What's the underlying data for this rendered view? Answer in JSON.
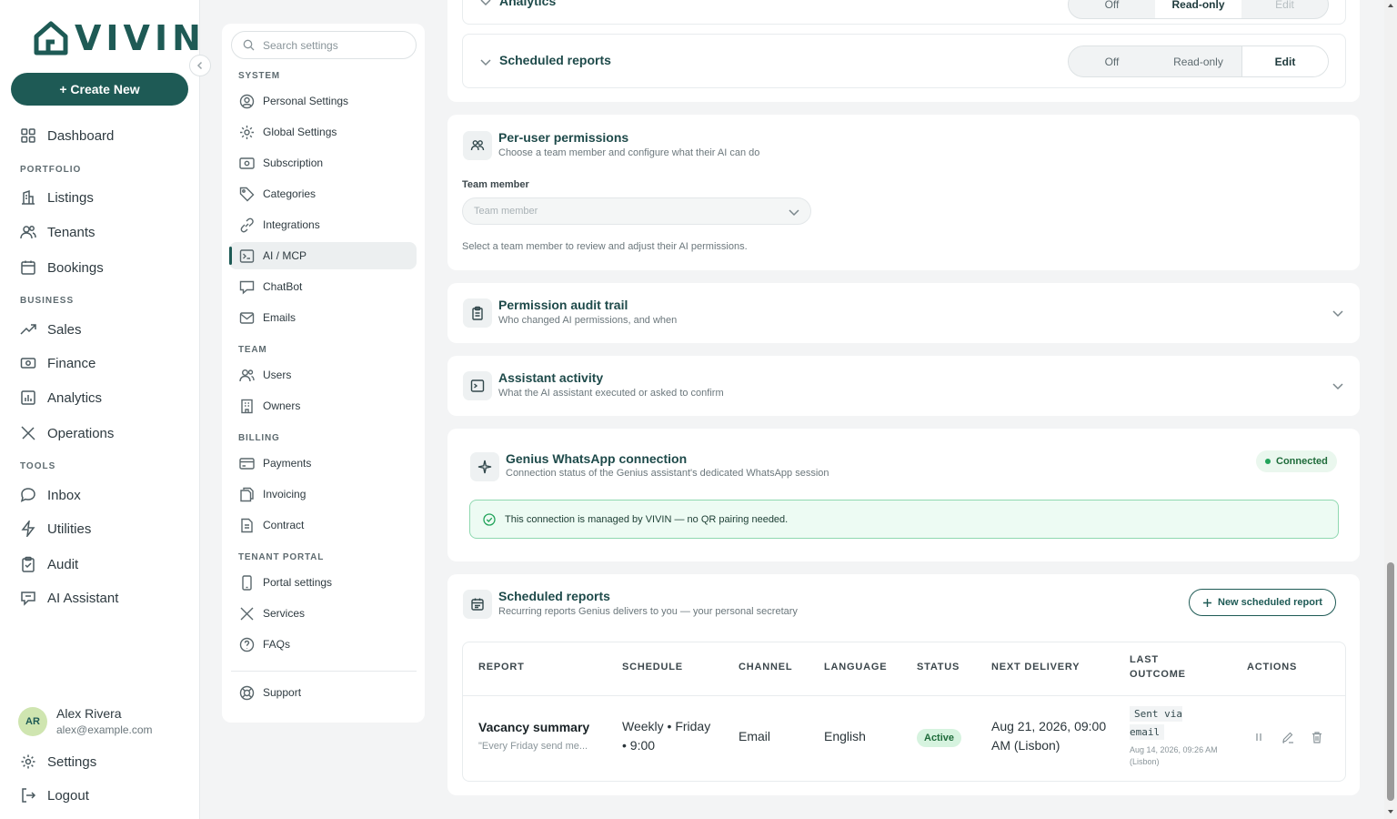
{
  "brand": {
    "logo_text": "VIVIN",
    "create_label": "+ Create New"
  },
  "nav": {
    "dashboard": "Dashboard",
    "portfolio_label": "PORTFOLIO",
    "listings": "Listings",
    "tenants": "Tenants",
    "bookings": "Bookings",
    "business_label": "BUSINESS",
    "sales": "Sales",
    "finance": "Finance",
    "analytics": "Analytics",
    "operations": "Operations",
    "tools_label": "TOOLS",
    "inbox": "Inbox",
    "utilities": "Utilities",
    "audit": "Audit",
    "ai_assistant": "AI Assistant",
    "settings": "Settings",
    "logout": "Logout"
  },
  "user": {
    "initials": "AR",
    "name": "Alex Rivera",
    "email": "alex@example.com"
  },
  "settings_menu": {
    "search_placeholder": "Search settings",
    "system_label": "SYSTEM",
    "personal": "Personal Settings",
    "global": "Global Settings",
    "subscription": "Subscription",
    "categories": "Categories",
    "integrations": "Integrations",
    "ai_mcp": "AI / MCP",
    "chatbot": "ChatBot",
    "emails": "Emails",
    "team_label": "TEAM",
    "users": "Users",
    "owners": "Owners",
    "billing_label": "BILLING",
    "payments": "Payments",
    "invoicing": "Invoicing",
    "contract": "Contract",
    "tenant_portal_label": "TENANT PORTAL",
    "portal_settings": "Portal settings",
    "services": "Services",
    "faqs": "FAQs",
    "support": "Support"
  },
  "access": {
    "analytics_label": "Analytics",
    "scheduled_label": "Scheduled reports",
    "options": [
      "Off",
      "Read-only",
      "Edit"
    ],
    "scheduled_selected": "Edit"
  },
  "per_user": {
    "title": "Per-user permissions",
    "subtitle": "Choose a team member and configure what their AI can do",
    "field_label": "Team member",
    "field_placeholder": "Team member",
    "hint": "Select a team member to review and adjust their AI permissions."
  },
  "audit_trail": {
    "title": "Permission audit trail",
    "subtitle": "Who changed AI permissions, and when"
  },
  "assistant_activity": {
    "title": "Assistant activity",
    "subtitle": "What the AI assistant executed or asked to confirm"
  },
  "whatsapp": {
    "title": "Genius WhatsApp connection",
    "subtitle": "Connection status of the Genius assistant's dedicated WhatsApp session",
    "status": "Connected",
    "notice": "This connection is managed by VIVIN — no QR pairing needed."
  },
  "reports": {
    "title": "Scheduled reports",
    "subtitle": "Recurring reports Genius delivers to you — your personal secretary",
    "new_button": "New scheduled report",
    "columns": [
      "REPORT",
      "SCHEDULE",
      "CHANNEL",
      "LANGUAGE",
      "STATUS",
      "NEXT DELIVERY",
      "LAST OUTCOME",
      "ACTIONS"
    ],
    "rows": [
      {
        "name": "Vacancy summary",
        "prompt": "\"Every Friday send me...",
        "schedule": "Weekly • Friday • 9:00",
        "channel": "Email",
        "language": "English",
        "status": "Active",
        "next_delivery": "Aug 21, 2026, 09:00 AM (Lisbon)",
        "last_outcome": "Sent via email",
        "last_outcome_time": "Aug 14, 2026, 09:26 AM (Lisbon)"
      }
    ]
  },
  "colors": {
    "brand": "#1e5a55",
    "active_badge": "#d6f3df",
    "connected": "#22a35a"
  }
}
